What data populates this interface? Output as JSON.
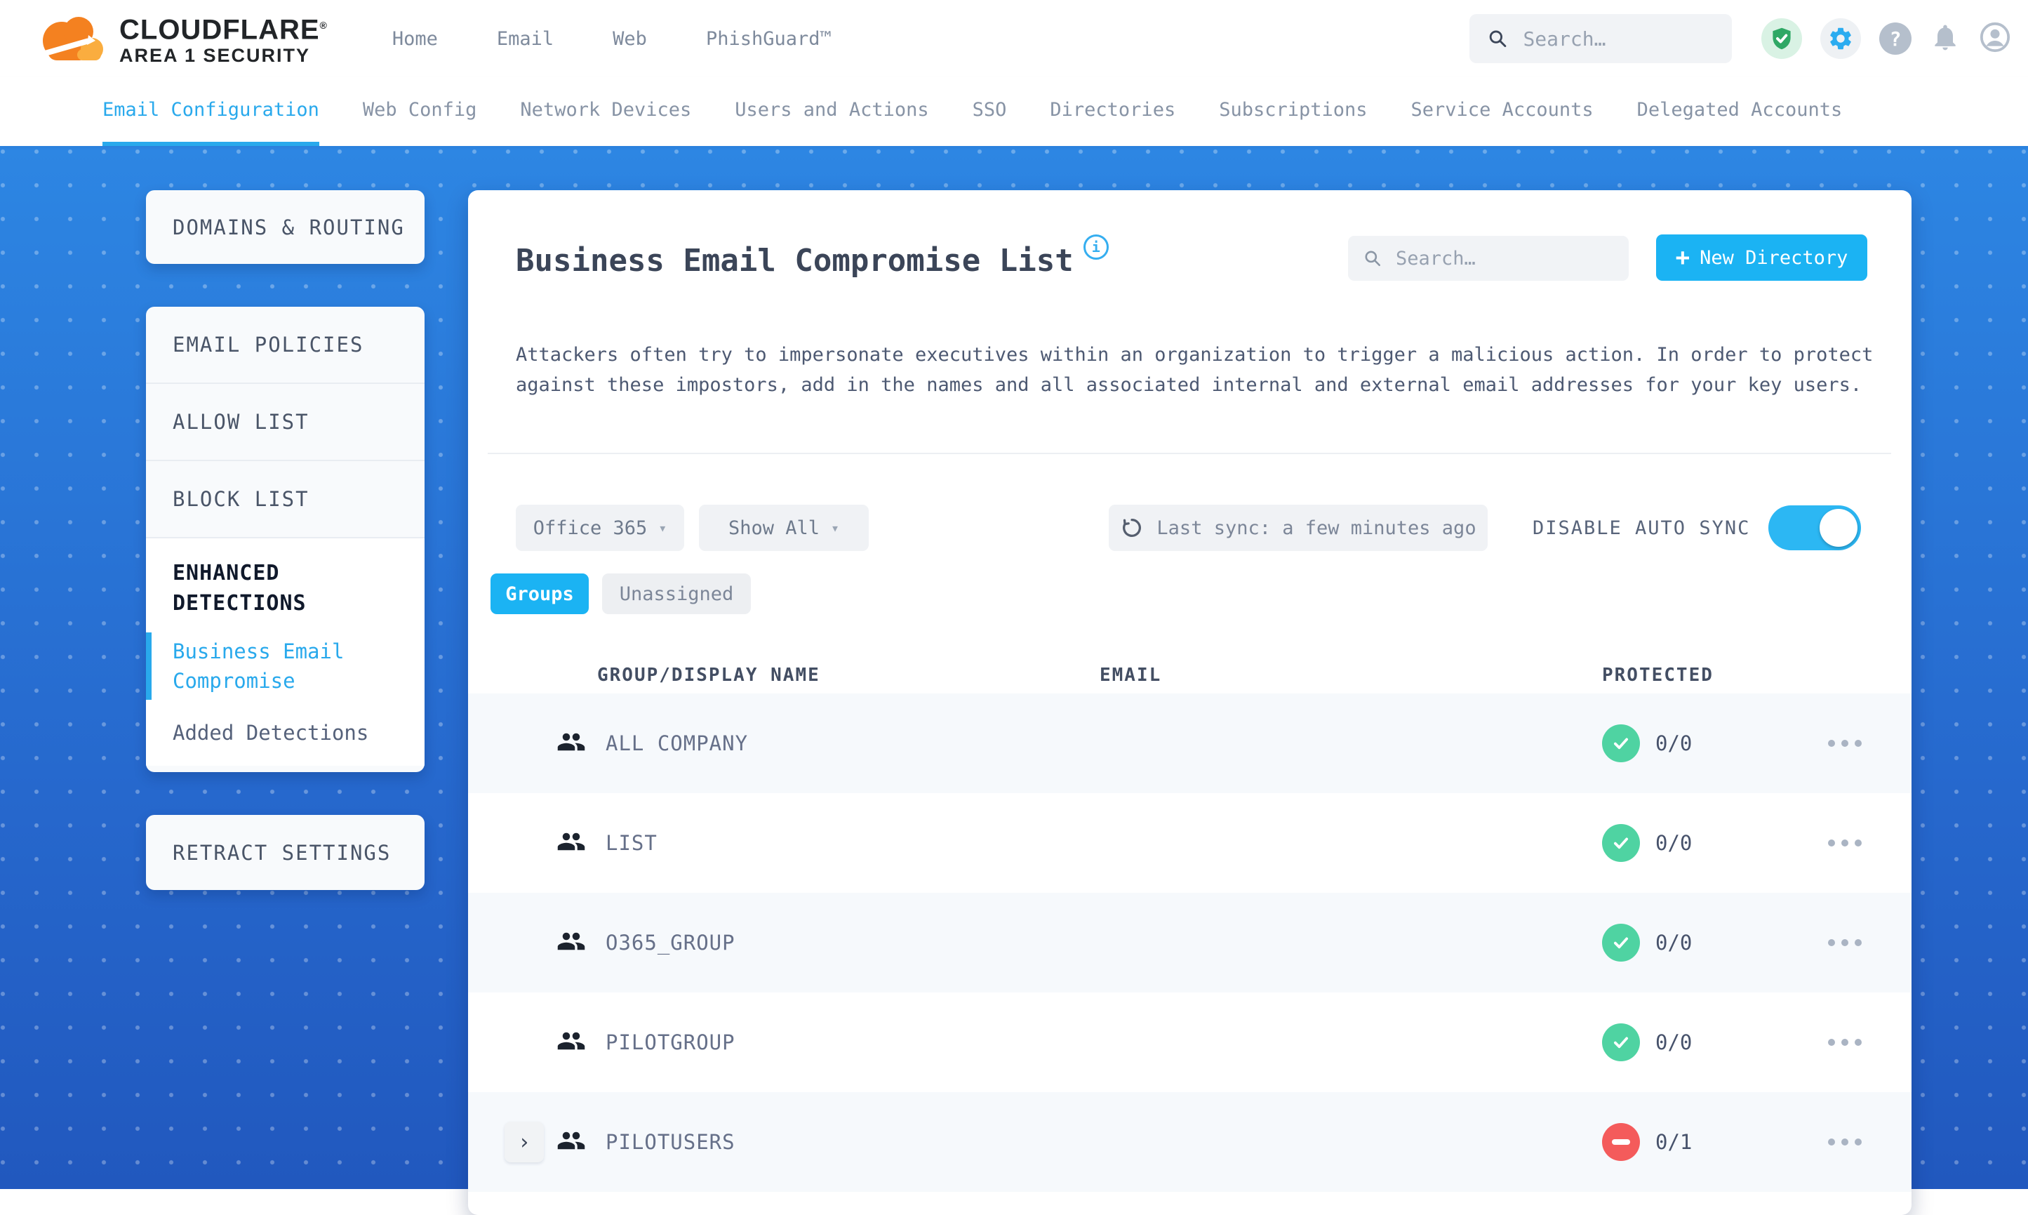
{
  "brand": {
    "name": "CLOUDFLARE",
    "mark": "®",
    "sub": "AREA 1 SECURITY"
  },
  "topnav": {
    "items": [
      "Home",
      "Email",
      "Web",
      "PhishGuard™"
    ]
  },
  "header_search": {
    "placeholder": "Search…"
  },
  "header_icons": [
    "shield-check",
    "gear",
    "help",
    "bell",
    "account"
  ],
  "tabs": {
    "items": [
      {
        "label": "Email Configuration",
        "active": true
      },
      {
        "label": "Web Config",
        "active": false
      },
      {
        "label": "Network Devices",
        "active": false
      },
      {
        "label": "Users and Actions",
        "active": false
      },
      {
        "label": "SSO",
        "active": false
      },
      {
        "label": "Directories",
        "active": false
      },
      {
        "label": "Subscriptions",
        "active": false
      },
      {
        "label": "Service Accounts",
        "active": false
      },
      {
        "label": "Delegated Accounts",
        "active": false
      }
    ]
  },
  "sidebar": {
    "domains_routing": "DOMAINS & ROUTING",
    "email_policies": "EMAIL POLICIES",
    "allow_list": "ALLOW LIST",
    "block_list": "BLOCK LIST",
    "enhanced_detections": "ENHANCED DETECTIONS",
    "business_email_compromise": "Business Email Compromise",
    "added_detections": "Added Detections",
    "retract_settings": "RETRACT SETTINGS"
  },
  "main": {
    "title": "Business Email Compromise List",
    "info": "i",
    "search_placeholder": "Search…",
    "new_directory": {
      "plus": "+",
      "label": "New Directory"
    },
    "description": "Attackers often try to impersonate executives within an organization to trigger a malicious action. In order to protect against these impostors, add in the names and all associated internal and external email addresses for your key users.",
    "filters": {
      "directory": "Office 365",
      "show": "Show All",
      "caret": "▾",
      "last_sync": "Last sync: a few minutes ago",
      "auto_sync_label": "DISABLE AUTO SYNC",
      "auto_sync_on": true
    },
    "view_tabs": {
      "groups": "Groups",
      "unassigned": "Unassigned"
    },
    "table": {
      "headers": [
        "GROUP/DISPLAY NAME",
        "EMAIL",
        "PROTECTED"
      ],
      "rows": [
        {
          "name": "ALL COMPANY",
          "email": "",
          "protected": "0/0",
          "status": "protected",
          "expandable": false
        },
        {
          "name": "LIST",
          "email": "",
          "protected": "0/0",
          "status": "protected",
          "expandable": false
        },
        {
          "name": "O365_GROUP",
          "email": "",
          "protected": "0/0",
          "status": "protected",
          "expandable": false
        },
        {
          "name": "PILOTGROUP",
          "email": "",
          "protected": "0/0",
          "status": "protected",
          "expandable": false
        },
        {
          "name": "PILOTUSERS",
          "email": "",
          "protected": "0/1",
          "status": "not_protected",
          "expandable": true
        }
      ]
    }
  },
  "colors": {
    "accent": "#1bb3f3",
    "active_tab": "#29a9ec",
    "green": "#4fd3a2",
    "red": "#f45b5b",
    "shield_green": "#2fa865"
  }
}
